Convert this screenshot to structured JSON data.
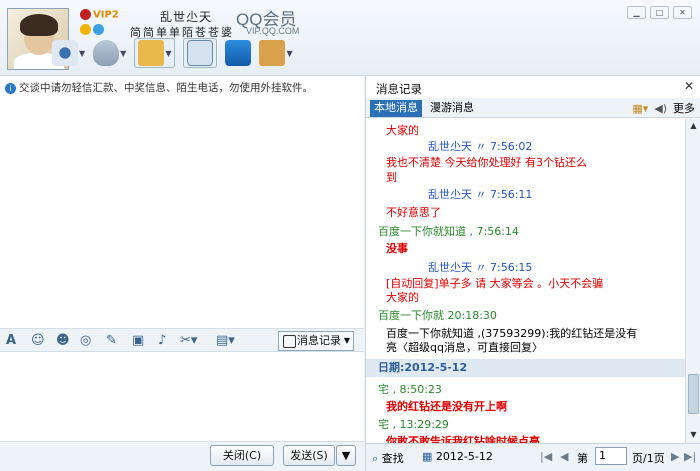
{
  "header": {
    "vip_label": "VIP2",
    "nickname": "乱世尐天",
    "signature": "简简单单陌苍苍婆",
    "brand": "QQ会员",
    "brand_url": "VIP.QQ.COM"
  },
  "notice": "交谈中请勿轻信汇款、中奖信息、陌生电话，勿使用外挂软件。",
  "format_bar": {
    "msglog_label": "消息记录"
  },
  "bottom": {
    "close_label": "关闭(C)",
    "send_label": "发送(S)"
  },
  "history": {
    "title": "消息记录",
    "tab_local": "本地消息",
    "tab_roaming": "漫游消息",
    "more": "更多",
    "messages": [
      {
        "text": "大家的",
        "style": "red"
      },
      {
        "text": "乱世尐天    〃   7:56:02",
        "style": "blue"
      },
      {
        "text": "我也不清楚  今天给你处理好    有3个钻还么",
        "style": "red"
      },
      {
        "text": "到",
        "style": "red"
      },
      {
        "text": "乱世尐天    〃   7:56:11",
        "style": "blue"
      },
      {
        "text": "不好意思了",
        "style": "red"
      },
      {
        "text": "百度一下你就知道 , 7:56:14",
        "style": "green"
      },
      {
        "text": "没事",
        "style": "redbold"
      },
      {
        "text": "乱世尐天    〃   7:56:15",
        "style": "blue"
      },
      {
        "text": "[自动回复]单子多  请  大家等会  。小天不会骗",
        "style": "red"
      },
      {
        "text": "大家的",
        "style": "red"
      },
      {
        "text": "百度一下你就  20:18:30",
        "style": "green"
      },
      {
        "text": "百度一下你就知道 ,(37593299):我的红钻还是没有",
        "style": "black"
      },
      {
        "text": "亮〈超级qq消息，可直接回复〉",
        "style": "black"
      },
      {
        "text": "日期:2012-5-12",
        "style": "date"
      },
      {
        "text": "宅      , 8:50:23",
        "style": "green"
      },
      {
        "text": "我的红钻还是没有开上啊",
        "style": "redbold"
      },
      {
        "text": "宅      , 13:29:29",
        "style": "green"
      },
      {
        "text": "你敢不敢告诉我红钻啥时候点亮",
        "style": "redbold"
      }
    ],
    "search_label": "查找",
    "date_label": "2012-5-12",
    "page_prefix": "第",
    "page_value": "1",
    "page_suffix": "页/1页"
  }
}
